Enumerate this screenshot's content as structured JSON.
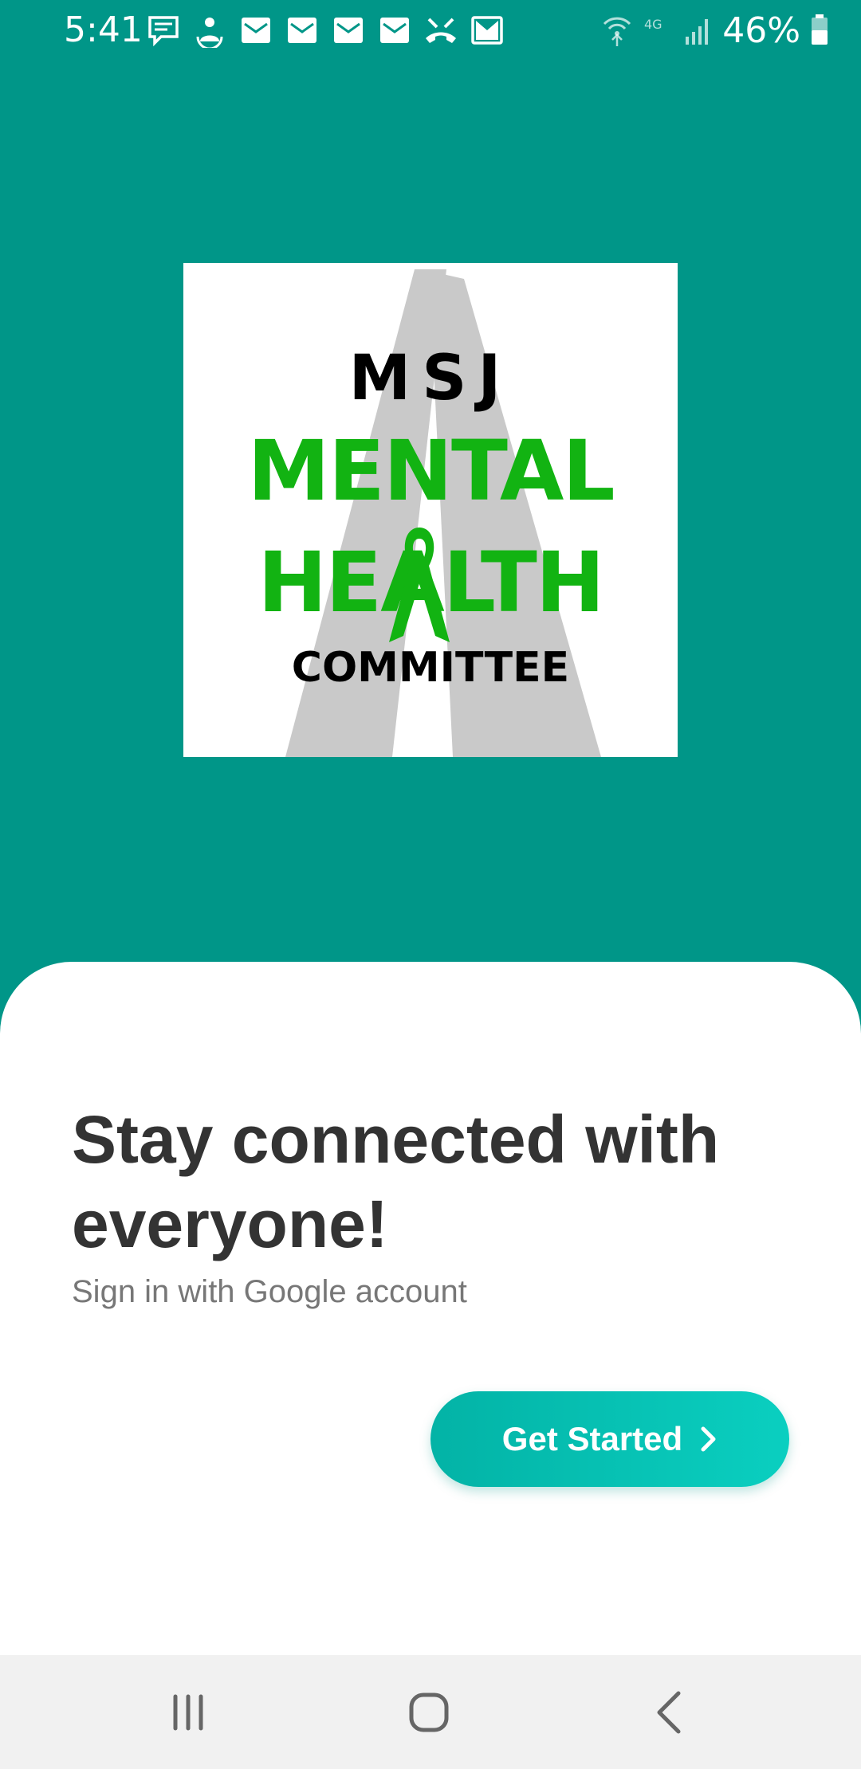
{
  "status_bar": {
    "time": "5:41",
    "network": "4G",
    "battery": "46%",
    "left_icons": [
      "message-icon",
      "sync-person-icon",
      "mail-icon",
      "mail-icon",
      "mail-icon",
      "mail-icon",
      "missed-call-icon",
      "gmail-icon"
    ],
    "right_icons": [
      "wifi-calling-icon",
      "lte-icon",
      "signal-icon",
      "battery-icon"
    ]
  },
  "logo": {
    "line1": "MSJ",
    "line2": "MENTAL",
    "line3": "HEALTH",
    "line4": "COMMITTEE",
    "brand_color": "#12b312"
  },
  "welcome": {
    "headline": "Stay connected with everyone!",
    "subline": "Sign in with Google account",
    "cta_label": "Get Started"
  },
  "nav_bar": {
    "buttons": [
      "recent-apps-icon",
      "home-icon",
      "back-icon"
    ]
  },
  "colors": {
    "background": "#009688",
    "accent": "#03b3a6"
  }
}
